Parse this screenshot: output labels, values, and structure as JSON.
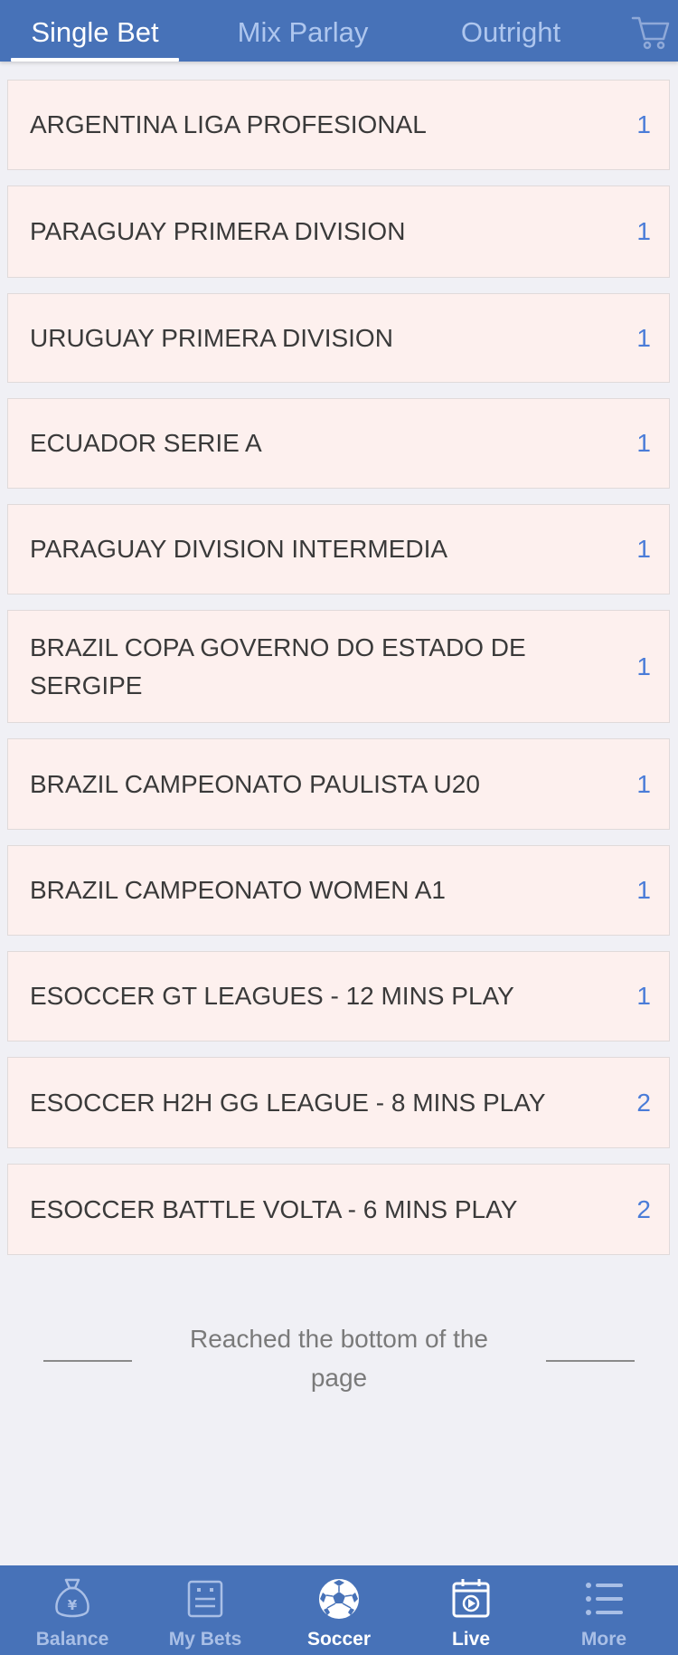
{
  "tabs": [
    {
      "label": "Single Bet",
      "active": true
    },
    {
      "label": "Mix Parlay",
      "active": false
    },
    {
      "label": "Outright",
      "active": false
    }
  ],
  "cart_icon": "shopping-cart-icon",
  "leagues": [
    {
      "name": "ARGENTINA LIGA PROFESIONAL",
      "count": "1"
    },
    {
      "name": "PARAGUAY PRIMERA DIVISION",
      "count": "1"
    },
    {
      "name": "URUGUAY PRIMERA DIVISION",
      "count": "1"
    },
    {
      "name": "ECUADOR SERIE A",
      "count": "1"
    },
    {
      "name": "PARAGUAY DIVISION INTERMEDIA",
      "count": "1"
    },
    {
      "name": "BRAZIL COPA GOVERNO DO ESTADO DE SERGIPE",
      "count": "1"
    },
    {
      "name": "BRAZIL CAMPEONATO PAULISTA U20",
      "count": "1"
    },
    {
      "name": "BRAZIL CAMPEONATO WOMEN A1",
      "count": "1"
    },
    {
      "name": "ESOCCER GT LEAGUES - 12 MINS PLAY",
      "count": "1"
    },
    {
      "name": "ESOCCER H2H GG LEAGUE - 8 MINS PLAY",
      "count": "2"
    },
    {
      "name": "ESOCCER BATTLE VOLTA - 6 MINS PLAY",
      "count": "2"
    }
  ],
  "end_message": "Reached the bottom of the page",
  "bottom_nav": [
    {
      "label": "Balance",
      "icon": "money-bag-icon",
      "active": false
    },
    {
      "label": "My Bets",
      "icon": "bet-slip-icon",
      "active": false
    },
    {
      "label": "Soccer",
      "icon": "soccer-ball-icon",
      "active": true
    },
    {
      "label": "Live",
      "icon": "live-video-icon",
      "active": true
    },
    {
      "label": "More",
      "icon": "menu-list-icon",
      "active": false
    }
  ],
  "colors": {
    "header": "#4772b8",
    "row_background": "#fdf0ee",
    "count_text": "#4a7cd8",
    "page_background": "#f0f0f5"
  }
}
